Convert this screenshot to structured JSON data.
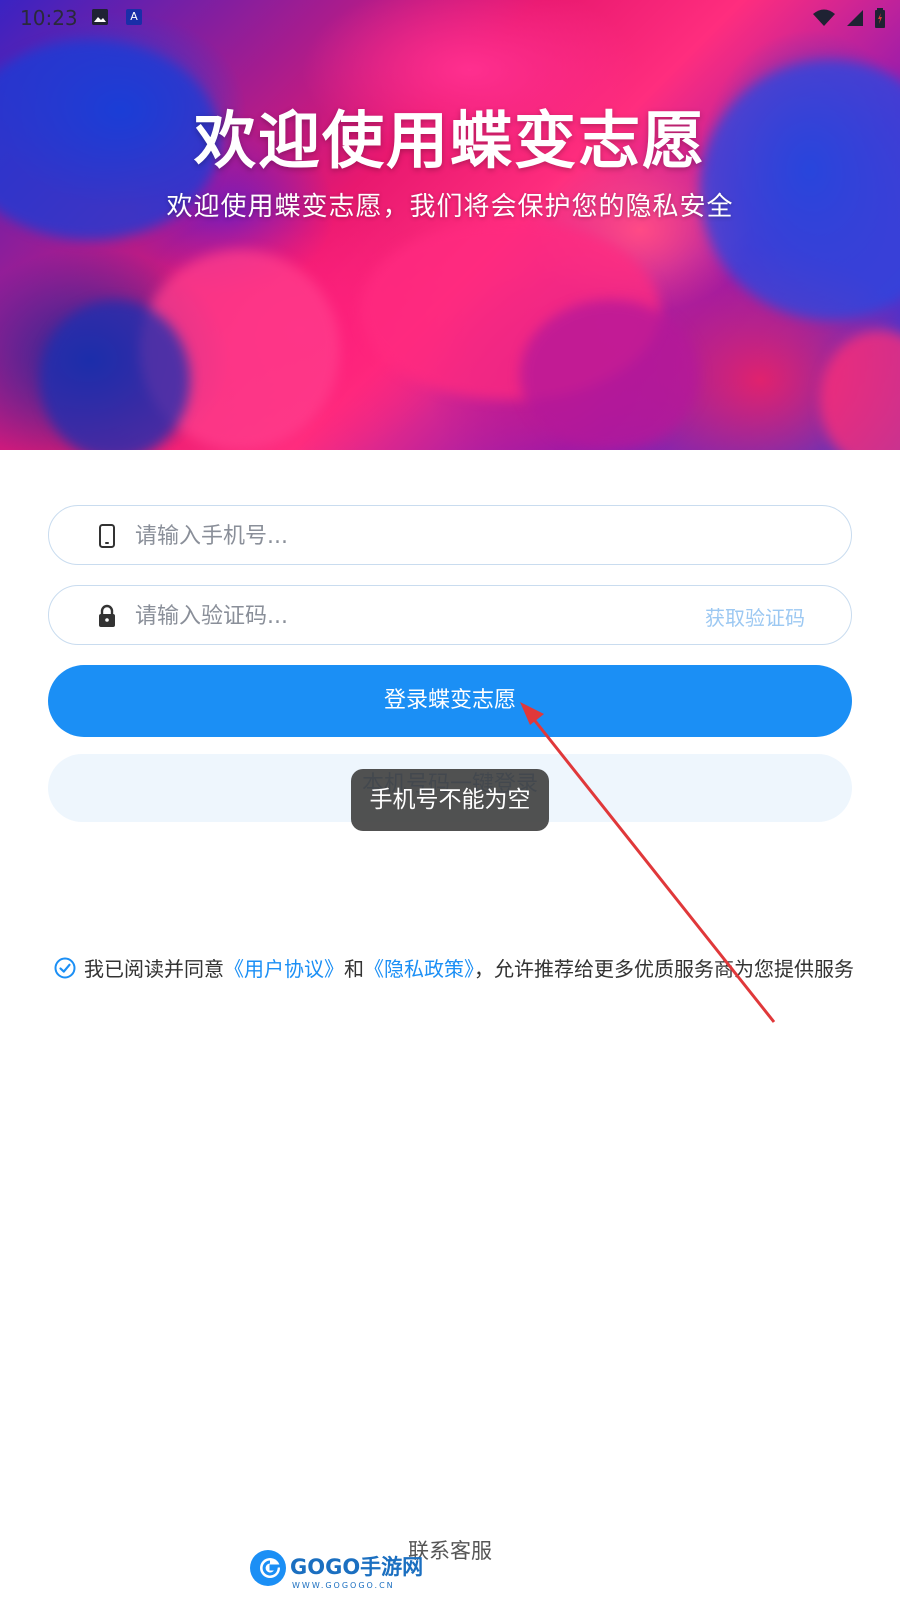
{
  "status_bar": {
    "time": "10:23",
    "icons": [
      "image-icon",
      "a-icon",
      "wifi-icon",
      "signal-icon",
      "battery-icon"
    ],
    "a_icon_letter": "A"
  },
  "hero": {
    "title": "欢迎使用蝶变志愿",
    "subtitle": "欢迎使用蝶变志愿，我们将会保护您的隐私安全"
  },
  "form": {
    "phone": {
      "placeholder": "请输入手机号...",
      "value": "",
      "icon": "phone-icon"
    },
    "code": {
      "placeholder": "请输入验证码...",
      "value": "",
      "icon": "lock-icon",
      "get_code_label": "获取验证码"
    },
    "login_label": "登录蝶变志愿",
    "quick_login_label": "本机号码一键登录"
  },
  "toast": {
    "message": "手机号不能为空"
  },
  "agreement": {
    "checked": true,
    "text_prefix": "我已阅读并同意",
    "user_agreement": "《用户协议》",
    "conjunction": "和",
    "privacy_policy": "《隐私政策》",
    "text_suffix": "，允许推荐给更多优质服务商为您提供服务"
  },
  "footer": {
    "contact_label": "联系客服"
  },
  "watermark": {
    "brand": "GOGO手游网",
    "url": "WWW.GOGOGO.CN"
  },
  "colors": {
    "primary": "#1b8ff5",
    "link": "#1b8ff5",
    "get_code": "#9cc8f2",
    "annotation_arrow": "#e0383a"
  }
}
